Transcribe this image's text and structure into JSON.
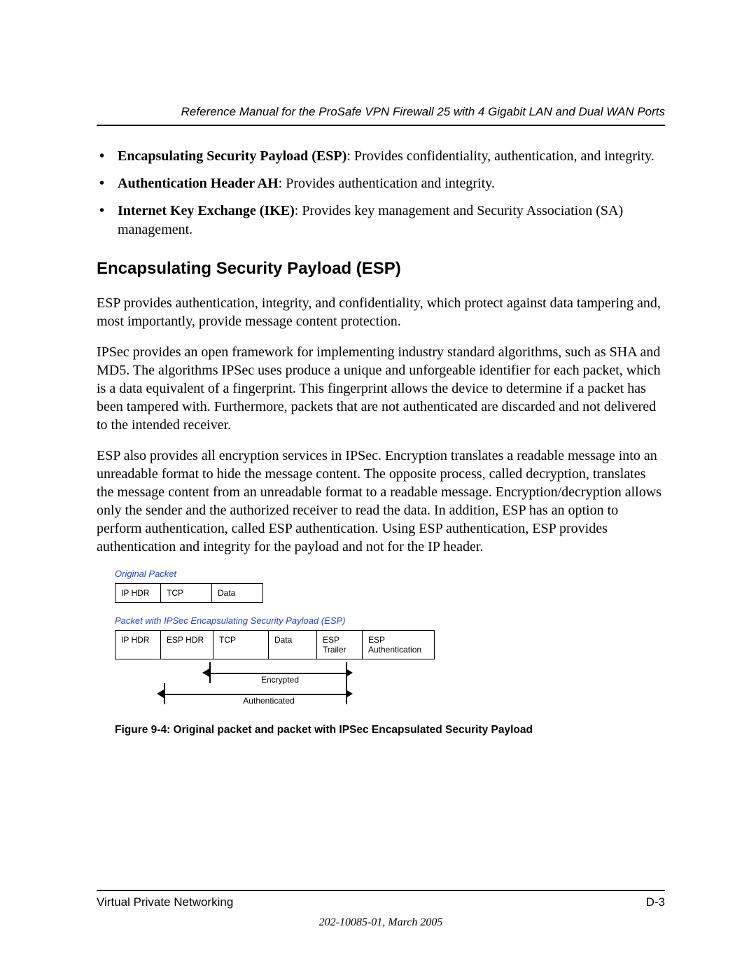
{
  "header": {
    "running_title": "Reference Manual for the ProSafe VPN Firewall 25 with 4 Gigabit LAN and Dual WAN Ports"
  },
  "bullets": [
    {
      "term": "Encapsulating Security Payload (ESP)",
      "desc": ": Provides confidentiality, authentication, and integrity."
    },
    {
      "term": "Authentication Header AH",
      "desc": ": Provides authentication and integrity."
    },
    {
      "term": "Internet Key Exchange (IKE)",
      "desc": ": Provides key management and Security Association (SA) management."
    }
  ],
  "section_heading": "Encapsulating Security Payload (ESP)",
  "paragraphs": {
    "p1": "ESP provides authentication, integrity, and confidentiality, which protect against data tampering and, most importantly, provide message content protection.",
    "p2": "IPSec provides an open framework for implementing industry standard algorithms, such as SHA and MD5. The algorithms IPSec uses produce a unique and unforgeable identifier for each packet, which is a data equivalent of a fingerprint. This fingerprint allows the device to determine if a packet has been tampered with. Furthermore, packets that are not authenticated are discarded and not delivered to the intended receiver.",
    "p3": "ESP also provides all encryption services in IPSec. Encryption translates a readable message into an unreadable format to hide the message content. The opposite process, called decryption, translates the message content from an unreadable format to a readable message. Encryption/decryption allows only the sender and the authorized receiver to read the data. In addition, ESP has an option to perform authentication, called ESP authentication. Using ESP authentication, ESP provides authentication and integrity for the payload and not for the IP header."
  },
  "figure": {
    "label_original": "Original Packet",
    "label_ipsec": "Packet with IPSec Encapsulating Security Payload (ESP)",
    "row1": [
      "IP HDR",
      "TCP",
      "Data"
    ],
    "row2": [
      "IP HDR",
      "ESP HDR",
      "TCP",
      "Data",
      "ESP Trailer",
      "ESP Authentication"
    ],
    "arrow_encrypted": "Encrypted",
    "arrow_authenticated": "Authenticated",
    "caption": "Figure 9-4:  Original packet and packet with IPSec Encapsulated Security Payload"
  },
  "footer": {
    "section": "Virtual Private Networking",
    "page": "D-3",
    "docnum": "202-10085-01, March 2005"
  }
}
